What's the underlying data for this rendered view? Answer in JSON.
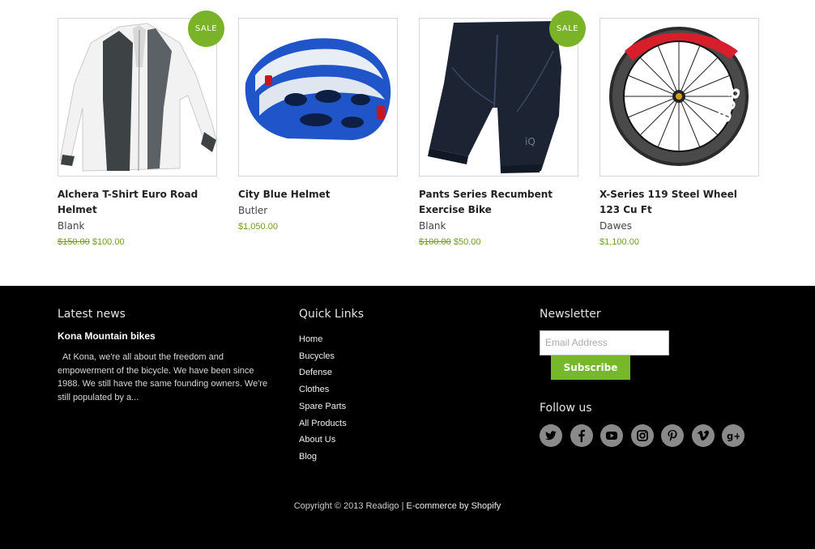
{
  "products": [
    {
      "title": "Alchera T-Shirt Euro Road Helmet",
      "vendor": "Blank",
      "old_price": "$150.00",
      "price": "$100.00",
      "badge": "SALE",
      "image": "white-jacket"
    },
    {
      "title": "City Blue Helmet",
      "vendor": "Butler",
      "old_price": "",
      "price": "$1,050.00",
      "badge": "",
      "image": "blue-helmet"
    },
    {
      "title": "Pants Series Recumbent Exercise Bike",
      "vendor": "Blank",
      "old_price": "$100.00",
      "price": "$50.00",
      "badge": "SALE",
      "image": "cycling-shorts"
    },
    {
      "title": "X-Series 119 Steel Wheel 123 Cu Ft",
      "vendor": "Dawes",
      "old_price": "",
      "price": "$1,100.00",
      "badge": "",
      "image": "carbon-wheel"
    }
  ],
  "footer": {
    "latest_news": {
      "heading": "Latest news",
      "post_title": "Kona Mountain bikes",
      "post_excerpt": "At Kona, we're all about the freedom and empowerment of the bicycle. We have been since 1988. We still have the same founding owners. We're still populated by a..."
    },
    "quick_links": {
      "heading": "Quick Links",
      "items": [
        "Home",
        "Bucycles",
        "Defense",
        "Clothes",
        "Spare Parts",
        "All Products",
        "About Us",
        "Blog"
      ]
    },
    "newsletter": {
      "heading": "Newsletter",
      "email_placeholder": "Email Address",
      "subscribe_label": "Subscribe"
    },
    "follow": {
      "heading": "Follow us",
      "icons": [
        "twitter-icon",
        "facebook-icon",
        "youtube-icon",
        "instagram-icon",
        "pinterest-icon",
        "vimeo-icon",
        "google-plus-icon"
      ]
    },
    "copyright": {
      "text": "Copyright © 2013 Readigo |",
      "link": "E-commerce by Shopify"
    }
  },
  "colors": {
    "accent": "#7ab328",
    "footer_bg": "#000000",
    "price": "#6e9e1e"
  }
}
